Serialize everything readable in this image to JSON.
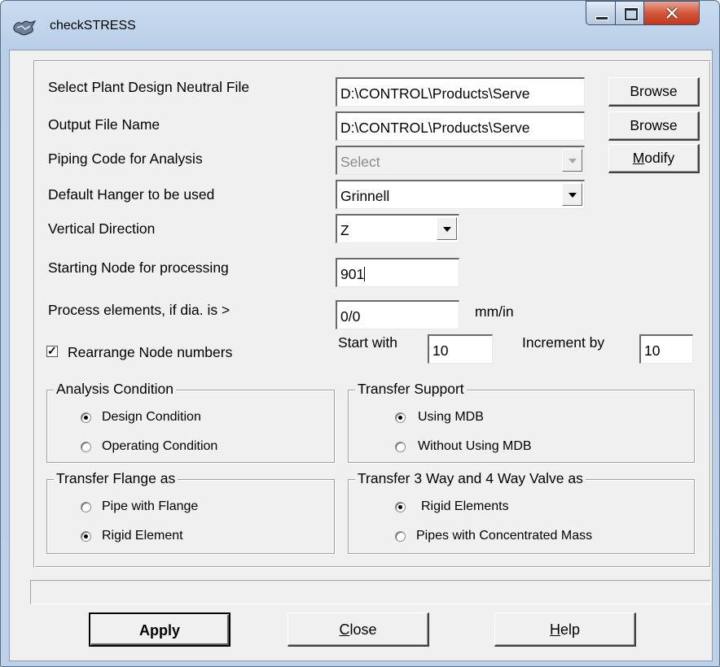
{
  "window": {
    "title": "checkSTRESS"
  },
  "form": {
    "pdn_label": "Select Plant Design Neutral File",
    "pdn_value": "D:\\CONTROL\\Products\\Serve",
    "browse1_label": "Browse",
    "output_label": "Output File Name",
    "output_value": "D:\\CONTROL\\Products\\Serve",
    "browse2_label": "Browse",
    "piping_label": "Piping Code for Analysis",
    "piping_value": "Select",
    "modify_label": "Modify",
    "modify_mnemonic": "M",
    "modify_rest": "odify",
    "hanger_label": "Default Hanger to be used",
    "hanger_value": "Grinnell",
    "vertical_label": "Vertical Direction",
    "vertical_value": "Z",
    "start_node_label": "Starting Node for processing",
    "start_node_value": "901",
    "dia_label": "Process elements, if dia. is >",
    "dia_value": "0/0",
    "dia_unit": "mm/in",
    "rearrange_label": "Rearrange Node numbers",
    "rearrange_checked": true,
    "start_with_label": "Start with",
    "start_with_value": "10",
    "increment_label": "Increment by",
    "increment_value": "10"
  },
  "groups": {
    "analysis": {
      "title": "Analysis Condition",
      "options": [
        "Design Condition",
        "Operating Condition"
      ],
      "selected": "Design Condition"
    },
    "transfer_support": {
      "title": "Transfer Support",
      "options": [
        "Using MDB",
        "Without Using MDB"
      ],
      "selected": "Using MDB"
    },
    "transfer_flange": {
      "title": "Transfer Flange as",
      "options": [
        "Pipe with Flange",
        "Rigid Element"
      ],
      "selected": "Rigid Element"
    },
    "transfer_valve": {
      "title": "Transfer 3 Way and 4 Way Valve as",
      "options": [
        "Rigid Elements",
        "Pipes with Concentrated Mass"
      ],
      "selected": "Rigid Elements"
    }
  },
  "status": {
    "text": ""
  },
  "buttons": {
    "apply_label": "Apply",
    "close_mnemonic": "C",
    "close_rest": "lose",
    "help_mnemonic": "H",
    "help_rest": "elp"
  },
  "icons": {
    "app": "checkstress-app-icon",
    "minimize": "minimize-icon",
    "maximize": "maximize-icon",
    "close": "close-icon"
  },
  "colors": {
    "titlebar": "#c9dbee",
    "close_button": "#c2381c",
    "client_bg": "#f0f0f0"
  }
}
